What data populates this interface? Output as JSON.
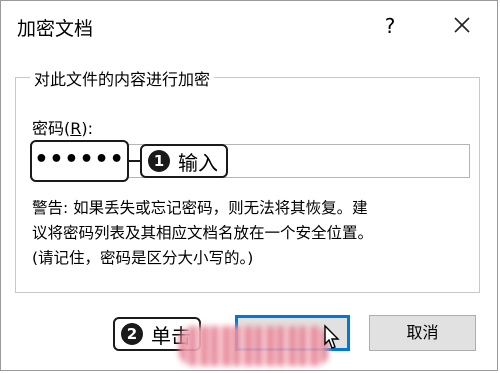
{
  "dialog": {
    "title": "加密文档",
    "help_label": "?",
    "close_icon": "close-icon"
  },
  "group": {
    "legend": "对此文件的内容进行加密",
    "password_label_prefix": "密码(",
    "password_label_accel": "R",
    "password_label_suffix": "):",
    "password_masked": "••••••",
    "warning_lines": [
      "警告: 如果丢失或忘记密码，则无法将其恢复。建",
      "议将密码列表及其相应文档名放在一个安全位置。",
      "(请记住，密码是区分大小写的。)"
    ]
  },
  "annotations": {
    "callout1_num": "1",
    "callout1_text": "输入",
    "callout2_num": "2",
    "callout2_text": "单击"
  },
  "buttons": {
    "ok_label": "",
    "cancel_label": "取消"
  },
  "colors": {
    "focus_blue": "#0078d7",
    "button_bg": "#e1e1e1"
  }
}
